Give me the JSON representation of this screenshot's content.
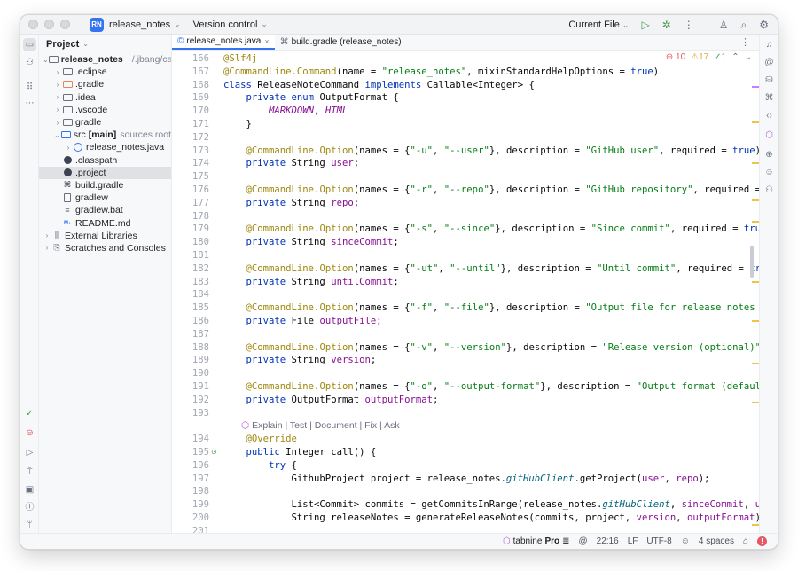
{
  "titlebar": {
    "project_badge": "RN",
    "project_name": "release_notes",
    "vcs": "Version control",
    "run_config": "Current File"
  },
  "project_panel": {
    "title": "Project",
    "tree": [
      {
        "label": "release_notes",
        "suffix": "~/.jbang/cac",
        "indent": 0,
        "arrow": "down",
        "icon": "folder",
        "bold": true
      },
      {
        "label": ".eclipse",
        "indent": 1,
        "arrow": "right",
        "icon": "folder"
      },
      {
        "label": ".gradle",
        "indent": 1,
        "arrow": "right",
        "icon": "folder-orange"
      },
      {
        "label": ".idea",
        "indent": 1,
        "arrow": "right",
        "icon": "folder"
      },
      {
        "label": ".vscode",
        "indent": 1,
        "arrow": "right",
        "icon": "folder"
      },
      {
        "label": "gradle",
        "indent": 1,
        "arrow": "right",
        "icon": "folder"
      },
      {
        "label": "src",
        "badge": "[main]",
        "suffix": "sources root",
        "indent": 1,
        "arrow": "down",
        "icon": "folder-src"
      },
      {
        "label": "release_notes.java",
        "indent": 2,
        "arrow": "right",
        "icon": "java"
      },
      {
        "label": ".classpath",
        "indent": 1,
        "arrow": "",
        "icon": "dot"
      },
      {
        "label": ".project",
        "indent": 1,
        "arrow": "",
        "icon": "dot",
        "selected": true
      },
      {
        "label": "build.gradle",
        "indent": 1,
        "arrow": "",
        "icon": "gradle"
      },
      {
        "label": "gradlew",
        "indent": 1,
        "arrow": "",
        "icon": "file"
      },
      {
        "label": "gradlew.bat",
        "indent": 1,
        "arrow": "",
        "icon": "lines"
      },
      {
        "label": "README.md",
        "indent": 1,
        "arrow": "",
        "icon": "md"
      },
      {
        "label": "External Libraries",
        "indent": 0,
        "arrow": "right",
        "icon": "library"
      },
      {
        "label": "Scratches and Consoles",
        "indent": 0,
        "arrow": "right",
        "icon": "scratch"
      }
    ]
  },
  "tabs": [
    {
      "label": "release_notes.java",
      "active": true,
      "icon": "java-icon"
    },
    {
      "label": "build.gradle (release_notes)",
      "active": false,
      "icon": "gradle-icon"
    }
  ],
  "inspections": {
    "errors": "10",
    "warnings": "17",
    "weak": "1"
  },
  "inlay_hint": "Explain | Test | Document | Fix | Ask",
  "code": [
    {
      "n": "166",
      "t": [
        [
          "an",
          "@Slf4j"
        ]
      ]
    },
    {
      "n": "167",
      "t": [
        [
          "an",
          "@CommandLine.Command"
        ],
        [
          "",
          "(name = "
        ],
        [
          "st",
          "\"release_notes\""
        ],
        [
          "",
          ", mixinStandardHelpOptions = "
        ],
        [
          "kw",
          "true"
        ],
        [
          "",
          ")"
        ]
      ]
    },
    {
      "n": "168",
      "t": [
        [
          "kw",
          "class "
        ],
        [
          "",
          "ReleaseNoteCommand "
        ],
        [
          "kw",
          "implements "
        ],
        [
          "",
          "Callable<Integer> {"
        ]
      ]
    },
    {
      "n": "169",
      "t": [
        [
          "",
          "    "
        ],
        [
          "kw",
          "private enum "
        ],
        [
          "",
          "OutputFormat {"
        ]
      ]
    },
    {
      "n": "170",
      "t": [
        [
          "",
          "        "
        ],
        [
          "en",
          "MARKDOWN"
        ],
        [
          "",
          ", "
        ],
        [
          "en",
          "HTML"
        ]
      ]
    },
    {
      "n": "171",
      "t": [
        [
          "",
          "    }"
        ]
      ]
    },
    {
      "n": "172",
      "t": [
        [
          "",
          ""
        ]
      ]
    },
    {
      "n": "173",
      "t": [
        [
          "",
          "    "
        ],
        [
          "an",
          "@CommandLine"
        ],
        [
          "",
          "."
        ],
        [
          "an",
          "Option"
        ],
        [
          "",
          "(names = {"
        ],
        [
          "st",
          "\"-u\""
        ],
        [
          "",
          ", "
        ],
        [
          "st",
          "\"--user\""
        ],
        [
          "",
          "}, description = "
        ],
        [
          "st",
          "\"GitHub user\""
        ],
        [
          "",
          ", required = "
        ],
        [
          "kw",
          "true"
        ],
        [
          "",
          ")"
        ]
      ]
    },
    {
      "n": "174",
      "t": [
        [
          "",
          "    "
        ],
        [
          "kw",
          "private "
        ],
        [
          "",
          "String "
        ],
        [
          "fd",
          "user"
        ],
        [
          "",
          ";"
        ]
      ]
    },
    {
      "n": "175",
      "t": [
        [
          "",
          ""
        ]
      ]
    },
    {
      "n": "176",
      "t": [
        [
          "",
          "    "
        ],
        [
          "an",
          "@CommandLine"
        ],
        [
          "",
          "."
        ],
        [
          "an",
          "Option"
        ],
        [
          "",
          "(names = {"
        ],
        [
          "st",
          "\"-r\""
        ],
        [
          "",
          ", "
        ],
        [
          "st",
          "\"--repo\""
        ],
        [
          "",
          "}, description = "
        ],
        [
          "st",
          "\"GitHub repository\""
        ],
        [
          "",
          ", required = "
        ],
        [
          "kw",
          "true"
        ],
        [
          "",
          ")"
        ]
      ]
    },
    {
      "n": "177",
      "t": [
        [
          "",
          "    "
        ],
        [
          "kw",
          "private "
        ],
        [
          "",
          "String "
        ],
        [
          "fd",
          "repo"
        ],
        [
          "",
          ";"
        ]
      ]
    },
    {
      "n": "178",
      "t": [
        [
          "",
          ""
        ]
      ]
    },
    {
      "n": "179",
      "t": [
        [
          "",
          "    "
        ],
        [
          "an",
          "@CommandLine"
        ],
        [
          "",
          "."
        ],
        [
          "an",
          "Option"
        ],
        [
          "",
          "(names = {"
        ],
        [
          "st",
          "\"-s\""
        ],
        [
          "",
          ", "
        ],
        [
          "st",
          "\"--since\""
        ],
        [
          "",
          "}, description = "
        ],
        [
          "st",
          "\"Since commit\""
        ],
        [
          "",
          ", required = "
        ],
        [
          "kw",
          "true"
        ],
        [
          "",
          ")"
        ]
      ]
    },
    {
      "n": "180",
      "t": [
        [
          "",
          "    "
        ],
        [
          "kw",
          "private "
        ],
        [
          "",
          "String "
        ],
        [
          "fd",
          "sinceCommit"
        ],
        [
          "",
          ";"
        ]
      ]
    },
    {
      "n": "181",
      "t": [
        [
          "",
          ""
        ]
      ]
    },
    {
      "n": "182",
      "t": [
        [
          "",
          "    "
        ],
        [
          "an",
          "@CommandLine"
        ],
        [
          "",
          "."
        ],
        [
          "an",
          "Option"
        ],
        [
          "",
          "(names = {"
        ],
        [
          "st",
          "\"-ut\""
        ],
        [
          "",
          ", "
        ],
        [
          "st",
          "\"--until\""
        ],
        [
          "",
          "}, description = "
        ],
        [
          "st",
          "\"Until commit\""
        ],
        [
          "",
          ", required = "
        ],
        [
          "kw",
          "true"
        ],
        [
          "",
          ")"
        ]
      ]
    },
    {
      "n": "183",
      "t": [
        [
          "",
          "    "
        ],
        [
          "kw",
          "private "
        ],
        [
          "",
          "String "
        ],
        [
          "fd",
          "untilCommit"
        ],
        [
          "",
          ";"
        ]
      ]
    },
    {
      "n": "184",
      "t": [
        [
          "",
          ""
        ]
      ]
    },
    {
      "n": "185",
      "t": [
        [
          "",
          "    "
        ],
        [
          "an",
          "@CommandLine"
        ],
        [
          "",
          "."
        ],
        [
          "an",
          "Option"
        ],
        [
          "",
          "(names = {"
        ],
        [
          "st",
          "\"-f\""
        ],
        [
          "",
          ", "
        ],
        [
          "st",
          "\"--file\""
        ],
        [
          "",
          "}, description = "
        ],
        [
          "st",
          "\"Output file for release notes (optio"
        ]
      ]
    },
    {
      "n": "186",
      "t": [
        [
          "",
          "    "
        ],
        [
          "kw",
          "private "
        ],
        [
          "",
          "File "
        ],
        [
          "fd",
          "outputFile"
        ],
        [
          "",
          ";"
        ]
      ]
    },
    {
      "n": "187",
      "t": [
        [
          "",
          ""
        ]
      ]
    },
    {
      "n": "188",
      "t": [
        [
          "",
          "    "
        ],
        [
          "an",
          "@CommandLine"
        ],
        [
          "",
          "."
        ],
        [
          "an",
          "Option"
        ],
        [
          "",
          "(names = {"
        ],
        [
          "st",
          "\"-v\""
        ],
        [
          "",
          ", "
        ],
        [
          "st",
          "\"--version\""
        ],
        [
          "",
          "}, description = "
        ],
        [
          "st",
          "\"Release version (optional)\""
        ],
        [
          "",
          ", defa"
        ]
      ]
    },
    {
      "n": "189",
      "t": [
        [
          "",
          "    "
        ],
        [
          "kw",
          "private "
        ],
        [
          "",
          "String "
        ],
        [
          "fd",
          "version"
        ],
        [
          "",
          ";"
        ]
      ]
    },
    {
      "n": "190",
      "t": [
        [
          "",
          ""
        ]
      ]
    },
    {
      "n": "191",
      "t": [
        [
          "",
          "    "
        ],
        [
          "an",
          "@CommandLine"
        ],
        [
          "",
          "."
        ],
        [
          "an",
          "Option"
        ],
        [
          "",
          "(names = {"
        ],
        [
          "st",
          "\"-o\""
        ],
        [
          "",
          ", "
        ],
        [
          "st",
          "\"--output-format\""
        ],
        [
          "",
          "}, description = "
        ],
        [
          "st",
          "\"Output format (default: MAR"
        ]
      ]
    },
    {
      "n": "192",
      "t": [
        [
          "",
          "    "
        ],
        [
          "kw",
          "private "
        ],
        [
          "",
          "OutputFormat "
        ],
        [
          "fd",
          "outputFormat"
        ],
        [
          "",
          ";"
        ]
      ]
    },
    {
      "n": "193",
      "t": [
        [
          "",
          ""
        ]
      ]
    },
    {
      "n": "194",
      "t": [
        [
          "",
          "    "
        ],
        [
          "an",
          "@Override"
        ]
      ]
    },
    {
      "n": "195",
      "t": [
        [
          "",
          "    "
        ],
        [
          "kw",
          "public "
        ],
        [
          "",
          "Integer "
        ],
        [
          "",
          "call() {"
        ]
      ]
    },
    {
      "n": "196",
      "t": [
        [
          "",
          "        "
        ],
        [
          "kw",
          "try "
        ],
        [
          "",
          "{"
        ]
      ]
    },
    {
      "n": "197",
      "t": [
        [
          "",
          "            GithubProject project = release_notes."
        ],
        [
          "mi",
          "gitHubClient"
        ],
        [
          "",
          ".getProject("
        ],
        [
          "fd",
          "user"
        ],
        [
          "",
          ", "
        ],
        [
          "fd",
          "repo"
        ],
        [
          "",
          ");"
        ]
      ]
    },
    {
      "n": "198",
      "t": [
        [
          "",
          ""
        ]
      ]
    },
    {
      "n": "199",
      "t": [
        [
          "",
          "            List<Commit> commits = getCommitsInRange(release_notes."
        ],
        [
          "mi",
          "gitHubClient"
        ],
        [
          "",
          ", "
        ],
        [
          "fd",
          "sinceCommit"
        ],
        [
          "",
          ", "
        ],
        [
          "fd",
          "untilCo"
        ]
      ]
    },
    {
      "n": "200",
      "t": [
        [
          "",
          "            String releaseNotes = generateReleaseNotes(commits, project, "
        ],
        [
          "fd",
          "version"
        ],
        [
          "",
          ", "
        ],
        [
          "fd",
          "outputFormat"
        ],
        [
          "",
          ");"
        ]
      ]
    },
    {
      "n": "201",
      "t": [
        [
          "",
          ""
        ]
      ]
    }
  ],
  "statusbar": {
    "tabnine": "tabnine",
    "tabnine_pro": "Pro",
    "position": "22:16",
    "line_sep": "LF",
    "encoding": "UTF-8",
    "indent": "4 spaces"
  },
  "colors": {
    "accent": "#3574f0",
    "keyword": "#0033b3",
    "string": "#067d17",
    "annotation": "#9e880d",
    "field": "#871094"
  }
}
